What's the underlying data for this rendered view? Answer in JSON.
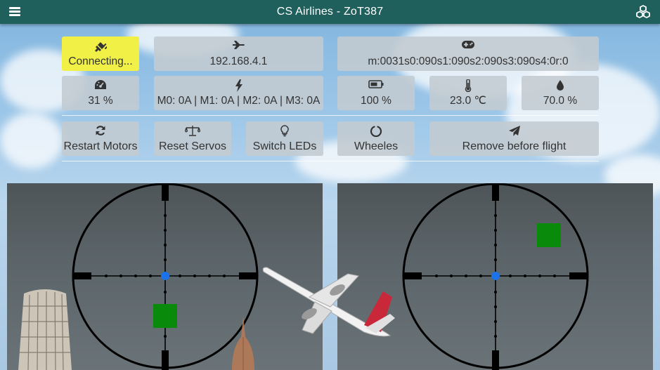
{
  "header": {
    "title": "CS Airlines - ZoT387",
    "menu_icon": "hamburger-menu-icon",
    "settings_icon": "cubes-icon"
  },
  "status": {
    "connection": {
      "icon": "plug-icon",
      "value": "Connecting...",
      "color": "#f0f046"
    },
    "address": {
      "icon": "plane-icon",
      "value": "192.168.4.1"
    },
    "controller": {
      "icon": "gamepad-icon",
      "value": "m:0031s0:090s1:090s2:090s3:090s4:0r:0"
    },
    "throttle": {
      "icon": "dashboard-icon",
      "value": "31 %"
    },
    "motors": {
      "icon": "lightning-icon",
      "value": "M0: 0A | M1: 0A | M2: 0A | M3: 0A"
    },
    "battery": {
      "icon": "battery-icon",
      "value": "100 %"
    },
    "temperature": {
      "icon": "thermometer-icon",
      "value": "23.0 ℃"
    },
    "humidity": {
      "icon": "droplet-icon",
      "value": "70.0 %"
    }
  },
  "buttons": {
    "restart_motors": {
      "icon": "refresh-icon",
      "label": "Restart Motors"
    },
    "reset_servos": {
      "icon": "balance-scale-icon",
      "label": "Reset Servos"
    },
    "switch_leds": {
      "icon": "lightbulb-icon",
      "label": "Switch LEDs"
    },
    "wheeles": {
      "icon": "circle-notch-icon",
      "label": "Wheeles"
    },
    "remove_before_flight": {
      "icon": "paper-plane-icon",
      "label": "Remove before flight"
    }
  },
  "joysticks": {
    "left": {
      "crosshair_color": "#000000",
      "center_color": "#1a73e8",
      "marker_color": "#0a8a0a"
    },
    "right": {
      "crosshair_color": "#000000",
      "center_color": "#1a73e8",
      "marker_color": "#0a8a0a"
    }
  },
  "colors": {
    "header": "#1f5f5c",
    "panel": "#c3cbd0"
  }
}
